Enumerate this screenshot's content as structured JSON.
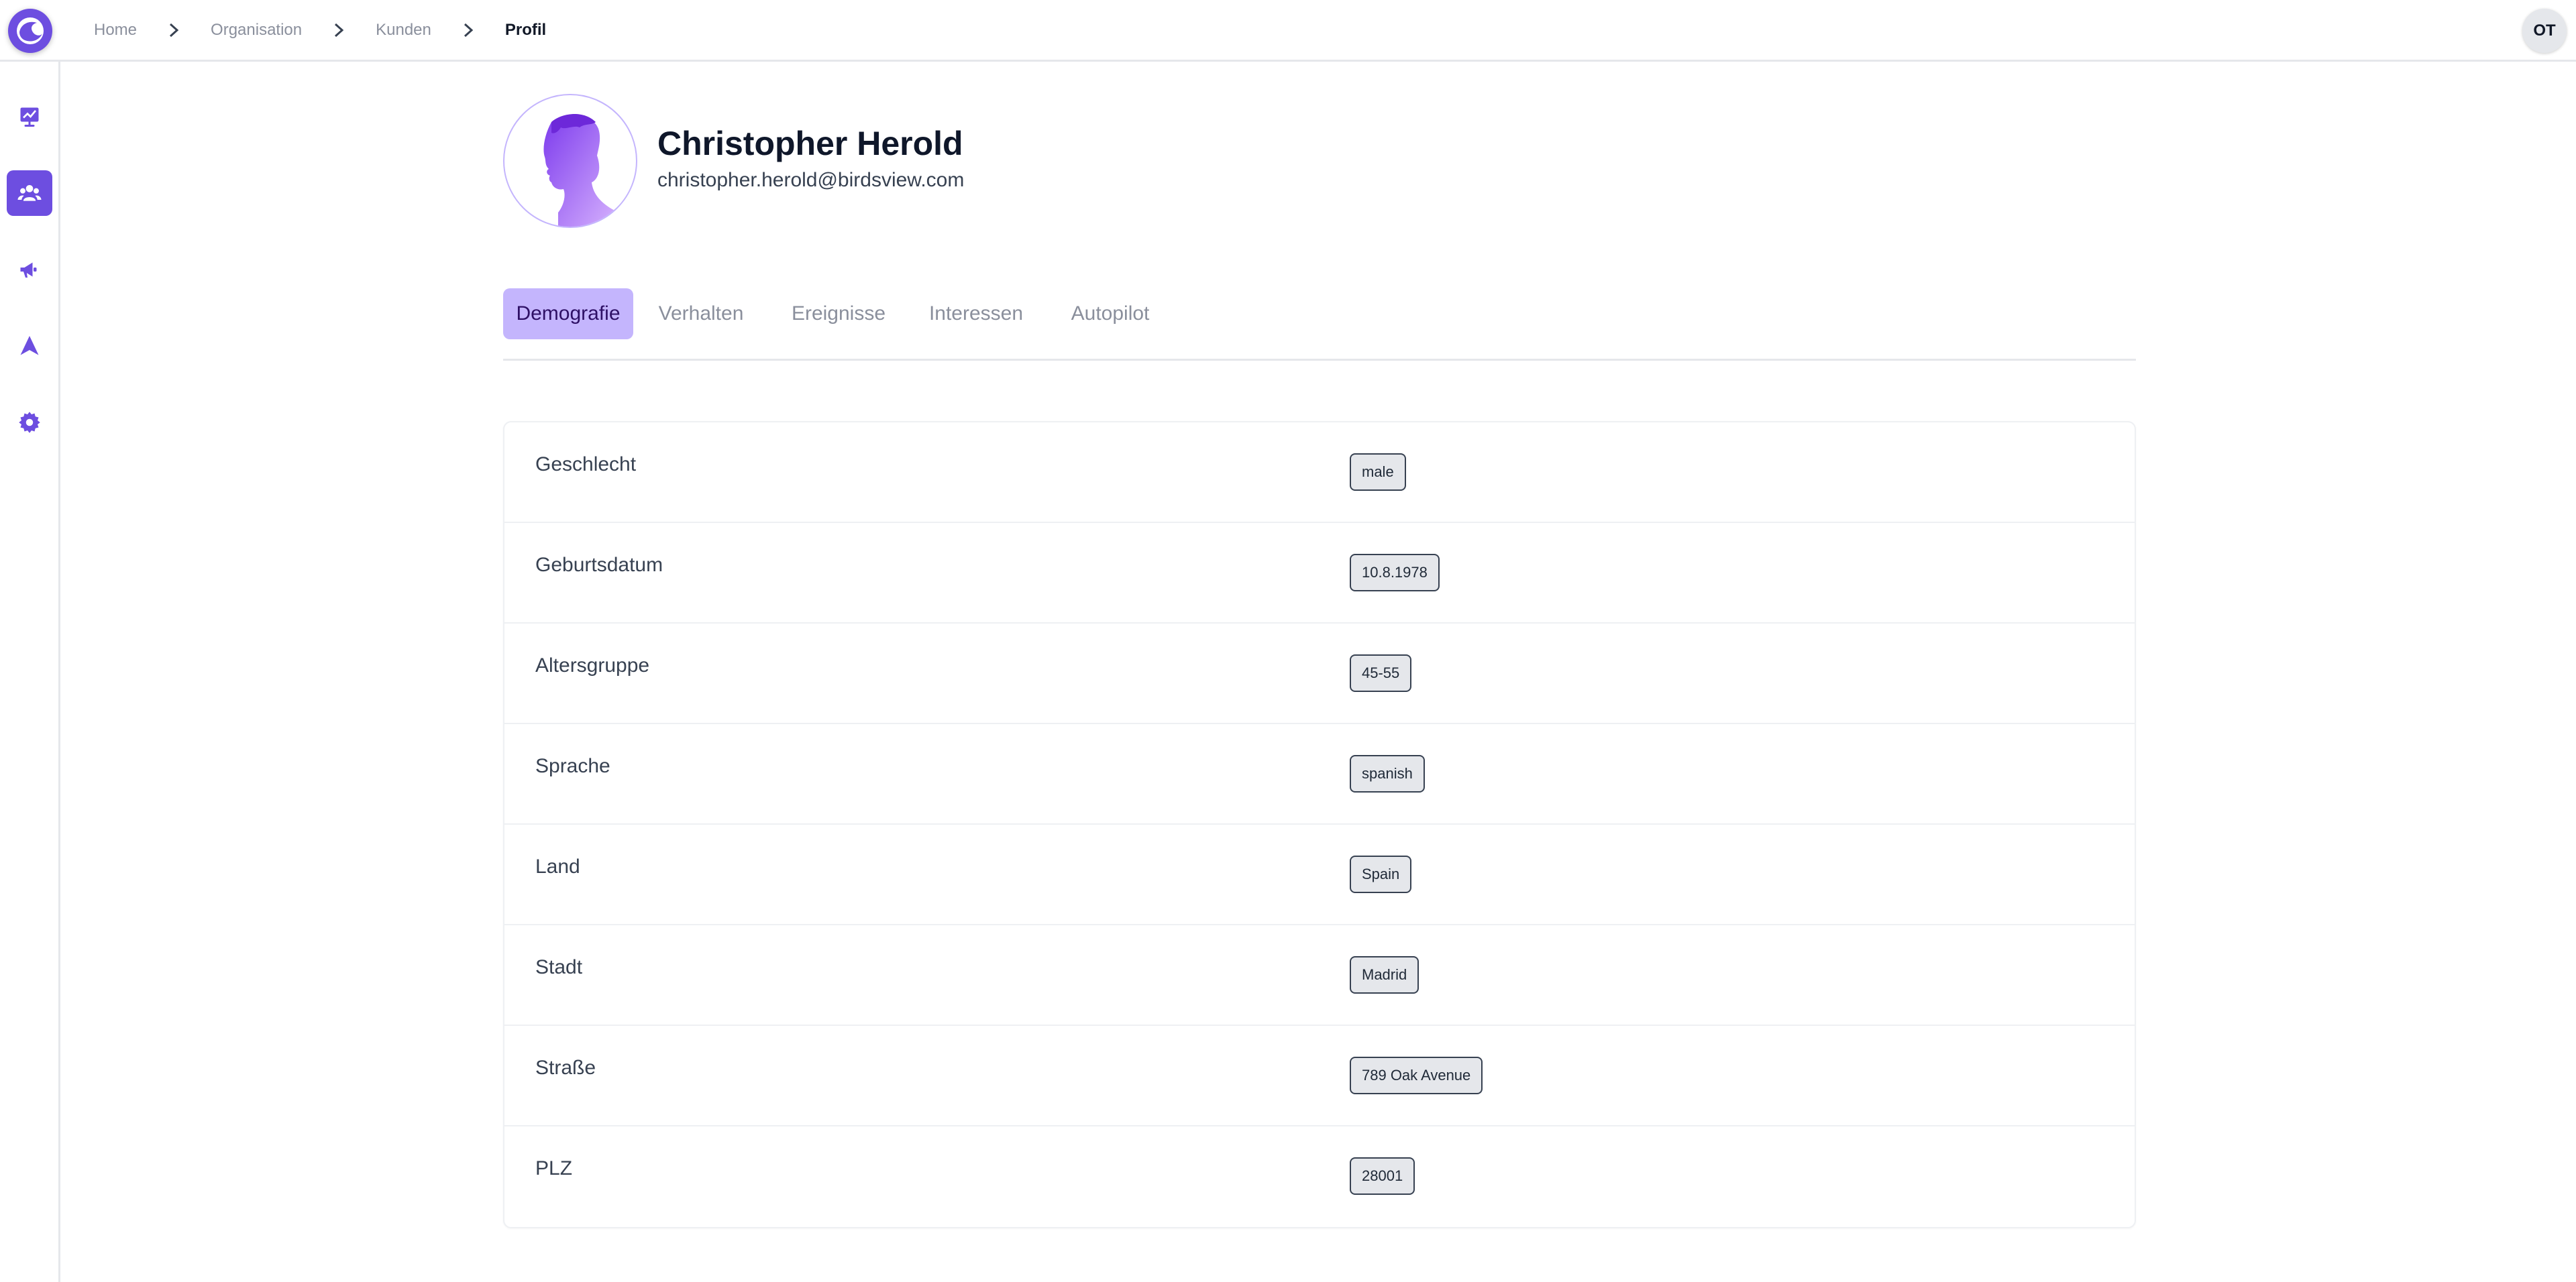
{
  "header": {
    "breadcrumbs": [
      {
        "label": "Home"
      },
      {
        "label": "Organisation"
      },
      {
        "label": "Kunden"
      },
      {
        "label": "Profil"
      }
    ],
    "user_initials": "OT"
  },
  "sidebar": {
    "items": [
      {
        "icon": "presentation-chart-icon",
        "active": false
      },
      {
        "icon": "users-icon",
        "active": true
      },
      {
        "icon": "megaphone-icon",
        "active": false
      },
      {
        "icon": "navigation-icon",
        "active": false
      },
      {
        "icon": "gear-icon",
        "active": false
      }
    ]
  },
  "profile": {
    "name": "Christopher Herold",
    "email": "christopher.herold@birdsview.com"
  },
  "tabs": [
    {
      "label": "Demografie",
      "active": true
    },
    {
      "label": "Verhalten",
      "active": false
    },
    {
      "label": "Ereignisse",
      "active": false
    },
    {
      "label": "Interessen",
      "active": false
    },
    {
      "label": "Autopilot",
      "active": false
    }
  ],
  "demographics": [
    {
      "label": "Geschlecht",
      "value": "male"
    },
    {
      "label": "Geburtsdatum",
      "value": "10.8.1978"
    },
    {
      "label": "Altersgruppe",
      "value": "45-55"
    },
    {
      "label": "Sprache",
      "value": "spanish"
    },
    {
      "label": "Land",
      "value": "Spain"
    },
    {
      "label": "Stadt",
      "value": "Madrid"
    },
    {
      "label": "Straße",
      "value": "789 Oak Avenue"
    },
    {
      "label": "PLZ",
      "value": "28001"
    }
  ],
  "colors": {
    "accent": "#6d4ee0",
    "tab_active_bg": "#c4b5fd",
    "chip_bg": "#e5e7eb"
  }
}
